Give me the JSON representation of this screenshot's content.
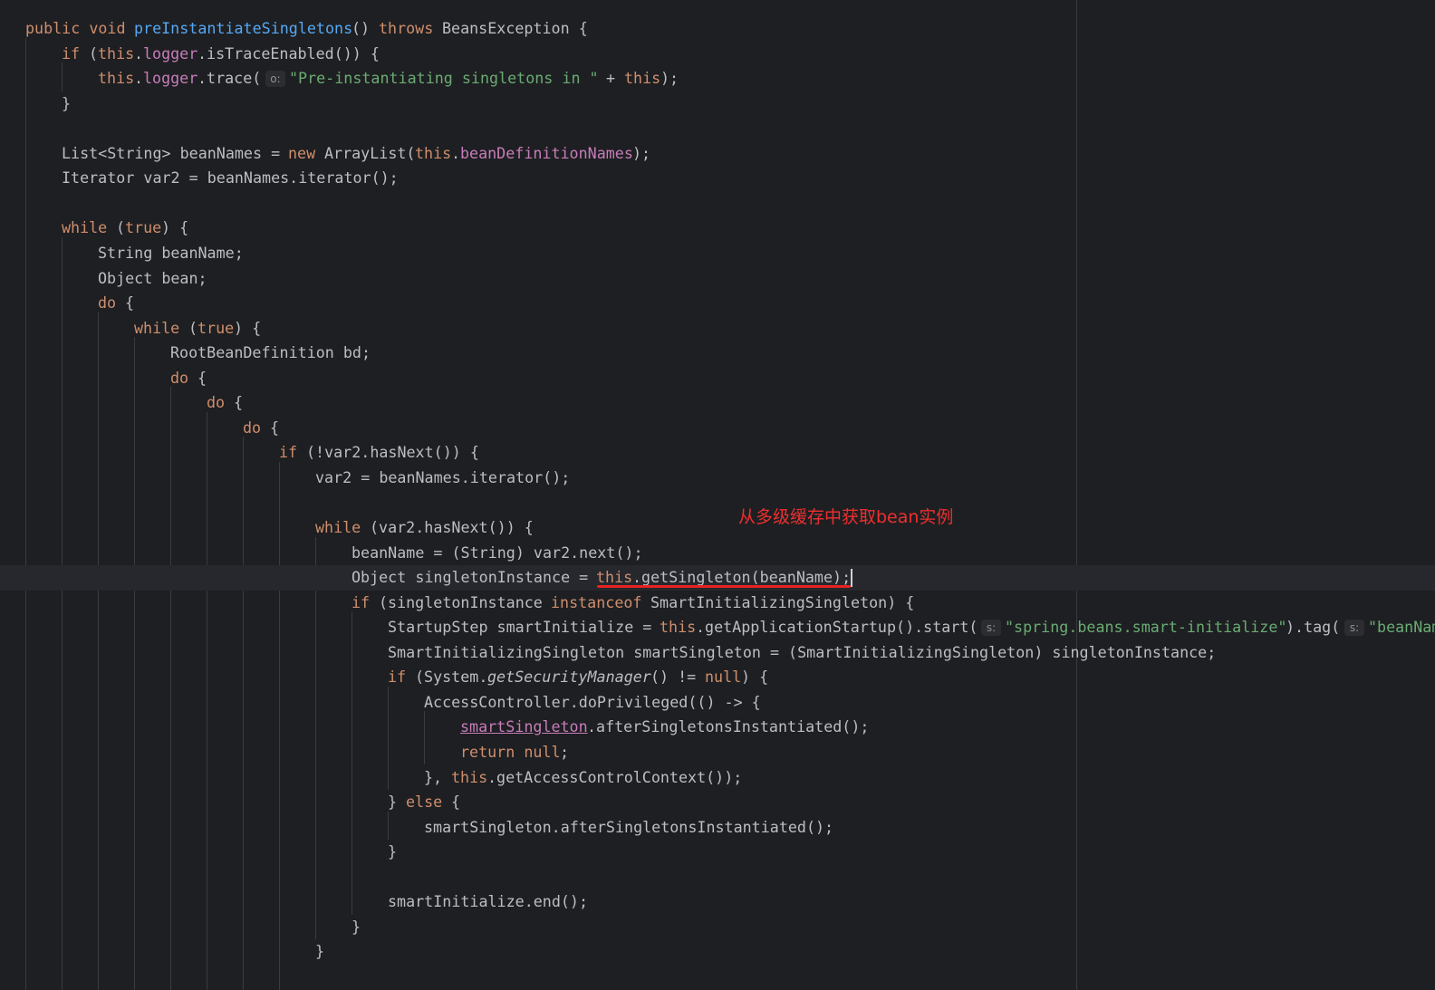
{
  "annotation": {
    "note": "从多级缓存中获取bean实例",
    "color": "#e8221f"
  },
  "colors": {
    "background": "#1e1f22",
    "keyword": "#cf8e6d",
    "method_declaration": "#56a8f5",
    "field": "#c77dba",
    "string": "#6aab73",
    "plain": "#bcbec4"
  },
  "code": {
    "current_line": 22,
    "lines": [
      [
        [
          "kw",
          "public void "
        ],
        [
          "fn",
          "preInstantiateSingletons"
        ],
        [
          "",
          "() "
        ],
        [
          "kw",
          "throws "
        ],
        [
          "",
          "BeansException {"
        ]
      ],
      [
        [
          "kw",
          "if "
        ],
        [
          "",
          "("
        ],
        [
          "kw",
          "this"
        ],
        [
          "",
          "."
        ],
        [
          "field",
          "logger"
        ],
        [
          "",
          ".isTraceEnabled()) {"
        ]
      ],
      [
        [
          "kw",
          "this"
        ],
        [
          "",
          "."
        ],
        [
          "field",
          "logger"
        ],
        [
          "",
          ".trace( "
        ],
        [
          "hint",
          "o:"
        ],
        [
          "str",
          "\"Pre-instantiating singletons in \""
        ],
        [
          "",
          " + "
        ],
        [
          "kw",
          "this"
        ],
        [
          "",
          ");"
        ]
      ],
      [
        [
          "",
          "}"
        ]
      ],
      [],
      [
        [
          "",
          "List<String> beanNames = "
        ],
        [
          "kw",
          "new "
        ],
        [
          "",
          "ArrayList("
        ],
        [
          "kw",
          "this"
        ],
        [
          "",
          "."
        ],
        [
          "field",
          "beanDefinitionNames"
        ],
        [
          "",
          ");"
        ]
      ],
      [
        [
          "",
          "Iterator var2 = beanNames.iterator();"
        ]
      ],
      [],
      [
        [
          "kw",
          "while "
        ],
        [
          "",
          "("
        ],
        [
          "kw",
          "true"
        ],
        [
          "",
          ") {"
        ]
      ],
      [
        [
          "",
          "String beanName;"
        ]
      ],
      [
        [
          "",
          "Object bean;"
        ]
      ],
      [
        [
          "kw",
          "do "
        ],
        [
          "",
          "{"
        ]
      ],
      [
        [
          "kw",
          "while "
        ],
        [
          "",
          "("
        ],
        [
          "kw",
          "true"
        ],
        [
          "",
          ") {"
        ]
      ],
      [
        [
          "",
          "RootBeanDefinition bd;"
        ]
      ],
      [
        [
          "kw",
          "do "
        ],
        [
          "",
          "{"
        ]
      ],
      [
        [
          "kw",
          "do "
        ],
        [
          "",
          "{"
        ]
      ],
      [
        [
          "kw",
          "do "
        ],
        [
          "",
          "{"
        ]
      ],
      [
        [
          "kw",
          "if "
        ],
        [
          "",
          "(!var2.hasNext()) {"
        ]
      ],
      [
        [
          "",
          "var2 = beanNames.iterator();"
        ]
      ],
      [],
      [
        [
          "kw",
          "while "
        ],
        [
          "",
          "(var2.hasNext()) {"
        ]
      ],
      [
        [
          "",
          "beanName = (String) var2.next();"
        ]
      ],
      [
        [
          "",
          "Object singletonInstance = "
        ],
        [
          "kw",
          "this"
        ],
        [
          "",
          ".getSingleton(beanName);"
        ]
      ],
      [
        [
          "kw",
          "if "
        ],
        [
          "",
          "(singletonInstance "
        ],
        [
          "kw",
          "instanceof "
        ],
        [
          "",
          "SmartInitializingSingleton) {"
        ]
      ],
      [
        [
          "",
          "StartupStep smartInitialize = "
        ],
        [
          "kw",
          "this"
        ],
        [
          "",
          ".getApplicationStartup().start( "
        ],
        [
          "hint",
          "s:"
        ],
        [
          "str",
          "\"spring.beans.smart-initialize\""
        ],
        [
          "",
          ").tag( "
        ],
        [
          "hint",
          "s:"
        ],
        [
          "str",
          "\"beanName\""
        ]
      ],
      [
        [
          "",
          "SmartInitializingSingleton smartSingleton = (SmartInitializingSingleton) singletonInstance;"
        ]
      ],
      [
        [
          "kw",
          "if "
        ],
        [
          "",
          "(System."
        ],
        [
          "italic",
          "getSecurityManager"
        ],
        [
          "",
          "() != "
        ],
        [
          "kw",
          "null"
        ],
        [
          "",
          ") {"
        ]
      ],
      [
        [
          "",
          "AccessController.doPrivileged(() -> {"
        ]
      ],
      [
        [
          "ufield",
          "smartSingleton"
        ],
        [
          "",
          ".afterSingletonsInstantiated();"
        ]
      ],
      [
        [
          "kw",
          "return null"
        ],
        [
          "",
          ";"
        ]
      ],
      [
        [
          "",
          "}, "
        ],
        [
          "kw",
          "this"
        ],
        [
          "",
          ".getAccessControlContext());"
        ]
      ],
      [
        [
          "",
          "} "
        ],
        [
          "kw",
          "else "
        ],
        [
          "",
          "{"
        ]
      ],
      [
        [
          "",
          "smartSingleton.afterSingletonsInstantiated();"
        ]
      ],
      [
        [
          "",
          "}"
        ]
      ],
      [],
      [
        [
          "",
          "smartInitialize.end();"
        ]
      ],
      [
        [
          "",
          "}"
        ]
      ],
      [
        [
          "",
          "}"
        ]
      ],
      []
    ]
  }
}
